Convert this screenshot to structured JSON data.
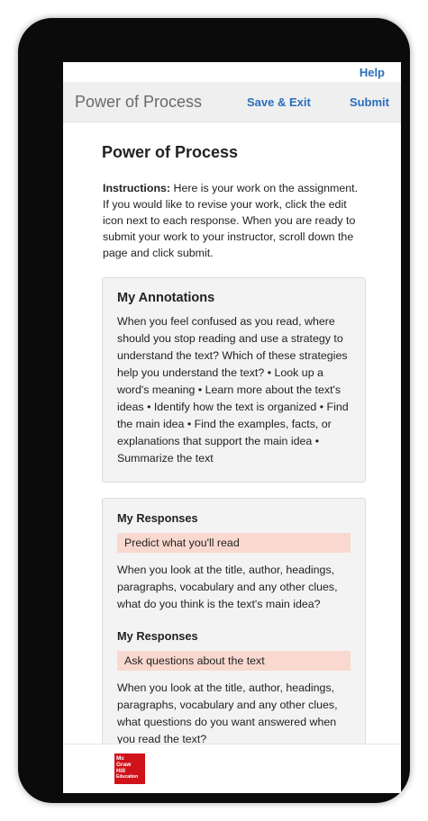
{
  "header": {
    "help": "Help",
    "title": "Power of Process",
    "save_exit": "Save & Exit",
    "submit": "Submit"
  },
  "page": {
    "title": "Power of Process",
    "instructions_lead": "Instructions:",
    "instructions_text": " Here is your work on the assignment. If you would like to revise your work, click the edit icon next to each response. When you are ready to submit your work to your instructor, scroll down the page and click submit."
  },
  "annotations": {
    "title": "My Annotations",
    "text": "When you feel confused as you read, where should you stop reading and use a strategy to understand the text? Which of these strategies help you understand the text? • Look up a word's meaning • Learn more about the text's ideas • Identify how the text is organized • Find the main idea • Find the examples, facts, or explanations that support the main idea • Summarize the text"
  },
  "responses": [
    {
      "title": "My Responses",
      "prompt": "Predict what you'll read",
      "text": "When you look at the title, author, headings, paragraphs, vocabulary and any other clues, what do you think is the text's main idea?"
    },
    {
      "title": "My Responses",
      "prompt": "Ask questions about the text",
      "text": "When you look at the title, author, headings, paragraphs, vocabulary and any other clues, what questions do you want answered when you read the text?"
    }
  ],
  "footer": {
    "logo_lines": [
      "Mc",
      "Graw",
      "Hill",
      "Education"
    ]
  },
  "colors": {
    "link": "#2a6ebb",
    "topbar": "#efefef",
    "card": "#f3f3f3",
    "highlight": "#f9d9cf",
    "logo": "#d0121b"
  }
}
